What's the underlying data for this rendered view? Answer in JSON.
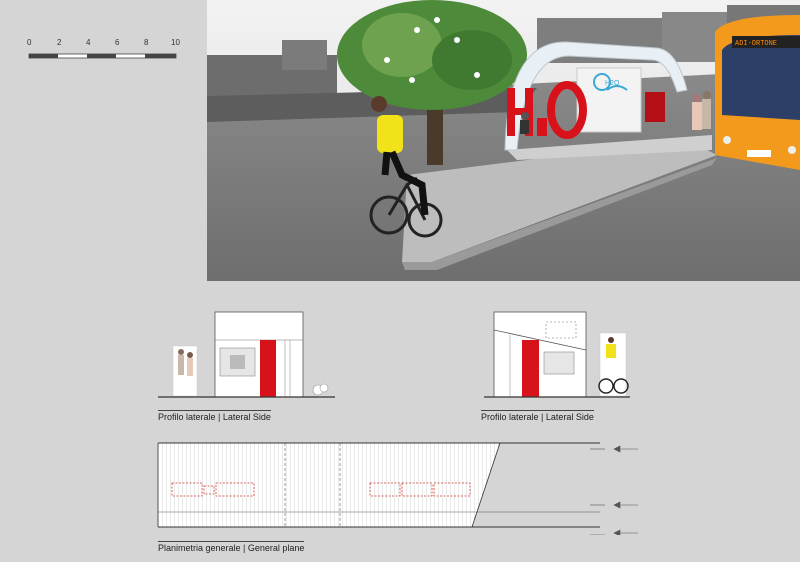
{
  "scale_bar": {
    "ticks": [
      "0",
      "2",
      "4",
      "6",
      "8",
      "10"
    ]
  },
  "render": {
    "bus_display": "ADI-ORTONE",
    "logo_text": "H2O"
  },
  "drawings": {
    "side_left_label": "Profilo laterale | Lateral Side",
    "side_right_label": "Profilo laterale | Lateral Side",
    "plan_label": "Planimetria generale | General plane"
  },
  "colors": {
    "accent_red": "#d8121b",
    "bus_orange": "#f39a1d",
    "cyclist_yellow": "#f2e21a",
    "plan_red": "#d23a30"
  }
}
